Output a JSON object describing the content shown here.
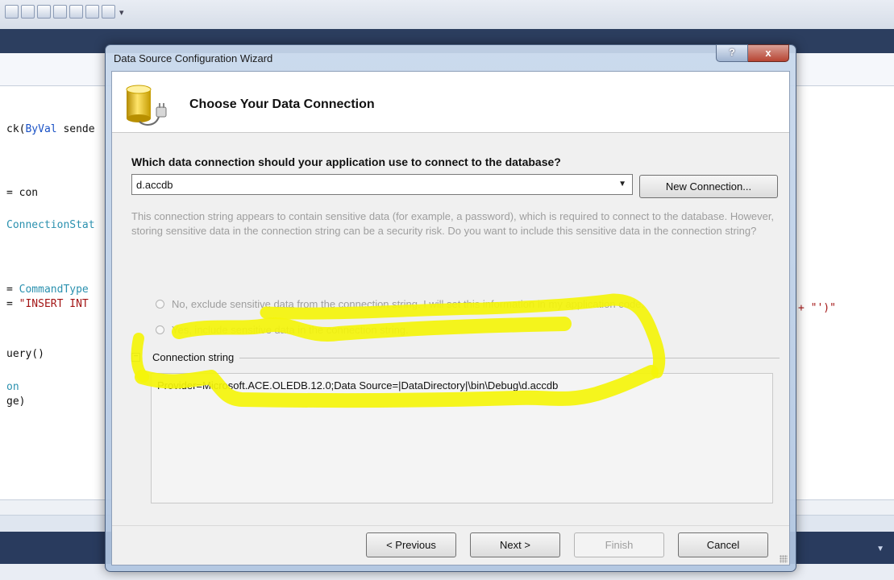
{
  "ide": {
    "code_lines": [
      {
        "segments": [
          {
            "t": "ck(",
            "c": ""
          },
          {
            "t": "ByVal",
            "c": "kw"
          },
          {
            "t": " sende",
            "c": ""
          }
        ]
      },
      {
        "segments": [
          {
            "t": "= con",
            "c": ""
          }
        ]
      },
      {
        "segments": [
          {
            "t": "ConnectionStat",
            "c": "ty"
          }
        ]
      },
      {
        "segments": [
          {
            "t": "= ",
            "c": ""
          },
          {
            "t": "CommandType",
            "c": "ty"
          }
        ]
      },
      {
        "segments": [
          {
            "t": "= ",
            "c": ""
          },
          {
            "t": "\"INSERT INT",
            "c": "st"
          }
        ]
      },
      {
        "segments": [
          {
            "t": "uery()",
            "c": ""
          }
        ]
      },
      {
        "segments": [
          {
            "t": "on",
            "c": "ty"
          }
        ]
      },
      {
        "segments": [
          {
            "t": "ge)",
            "c": ""
          }
        ]
      }
    ],
    "right_code": "+ \"')\""
  },
  "dialog": {
    "title": "Data Source Configuration Wizard",
    "help_label": "?",
    "close_label": "x",
    "header_title": "Choose Your Data Connection",
    "question": "Which data connection should your application use to connect to the database?",
    "connection_selected": "d.accdb",
    "new_connection_label": "New Connection...",
    "warning_text": "This connection string appears to contain sensitive data (for example, a password), which is required to connect to the database. However, storing sensitive data in the connection string can be a security risk. Do you want to include this sensitive data in the connection string?",
    "radio_no_label": "No, exclude sensitive data from the connection string. I will set this information in my application code.",
    "radio_yes_label": "Yes, include sensitive data in the connection string.",
    "connection_string_label": "Connection string",
    "connection_string_value": "Provider=Microsoft.ACE.OLEDB.12.0;Data Source=|DataDirectory|\\bin\\Debug\\d.accdb",
    "buttons": {
      "previous": "< Previous",
      "next": "Next >",
      "finish": "Finish",
      "cancel": "Cancel"
    },
    "expander_glyph": "−",
    "combo_arrow": "▼"
  },
  "colors": {
    "highlight": "#f4f40a"
  }
}
